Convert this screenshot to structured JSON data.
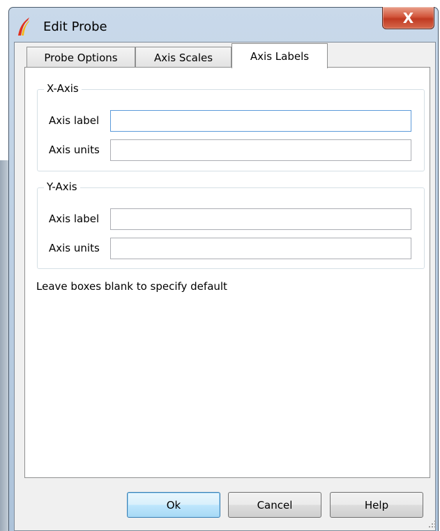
{
  "window": {
    "title": "Edit Probe",
    "close_label": "X"
  },
  "tabs": [
    {
      "label": "Probe Options"
    },
    {
      "label": "Axis Scales"
    },
    {
      "label": "Axis Labels"
    }
  ],
  "x_axis": {
    "title": "X-Axis",
    "label_caption": "Axis label",
    "label_value": "",
    "units_caption": "Axis units",
    "units_value": ""
  },
  "y_axis": {
    "title": "Y-Axis",
    "label_caption": "Axis label",
    "label_value": "",
    "units_caption": "Axis units",
    "units_value": ""
  },
  "hint": "Leave boxes blank to specify default",
  "buttons": {
    "ok": "Ok",
    "cancel": "Cancel",
    "help": "Help"
  }
}
